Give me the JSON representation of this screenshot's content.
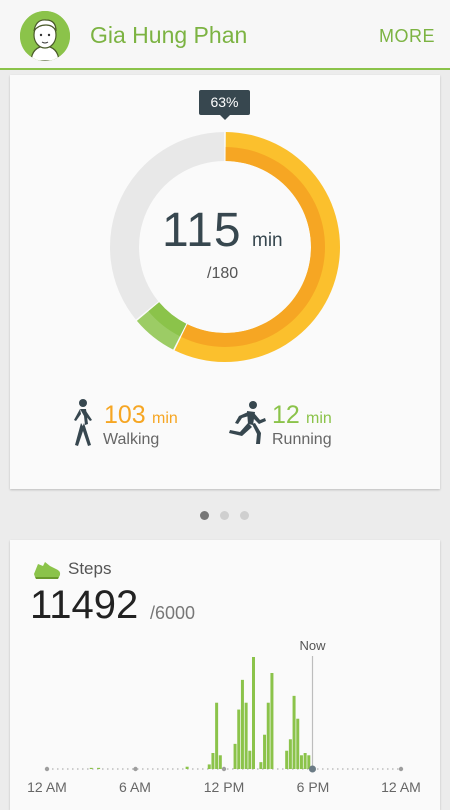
{
  "header": {
    "user_name": "Gia Hung Phan",
    "more_label": "MORE",
    "accent_color": "#8bc34a"
  },
  "activity": {
    "percent": "63%",
    "total_minutes": "115",
    "unit": "min",
    "goal": "/180",
    "walking": {
      "value": "103",
      "unit": "min",
      "label": "Walking",
      "minutes": 103
    },
    "running": {
      "value": "12",
      "unit": "min",
      "label": "Running",
      "minutes": 12
    },
    "goal_minutes": 180,
    "colors": {
      "walking": "#f6a623",
      "running": "#8bc34a",
      "remaining": "#e8e8e8"
    }
  },
  "pager": {
    "pages": 3,
    "active": 0
  },
  "steps": {
    "title": "Steps",
    "count": "11492",
    "goal": "/6000",
    "now_label": "Now",
    "x_labels": [
      "12 AM",
      "6 AM",
      "12 PM",
      "6 PM",
      "12 AM"
    ],
    "icon": "shoe-icon"
  },
  "chart_data": {
    "type": "bar",
    "title": "Steps",
    "xlabel": "",
    "ylabel": "",
    "x_ticks": [
      "12 AM",
      "6 AM",
      "12 PM",
      "6 PM",
      "12 AM"
    ],
    "x": [
      3.0,
      3.5,
      9.5,
      11.0,
      11.25,
      11.5,
      11.75,
      12.75,
      13.0,
      13.25,
      13.5,
      13.75,
      14.0,
      14.5,
      14.75,
      15.0,
      15.25,
      16.25,
      16.5,
      16.75,
      17.0,
      17.25,
      17.5,
      17.75
    ],
    "values": [
      1,
      1,
      2,
      4,
      14,
      58,
      12,
      22,
      52,
      78,
      58,
      16,
      98,
      6,
      30,
      58,
      84,
      16,
      26,
      64,
      44,
      12,
      14,
      12
    ],
    "now_hour": 18.0,
    "xlim": [
      0,
      24
    ],
    "color": "#8bc34a"
  }
}
